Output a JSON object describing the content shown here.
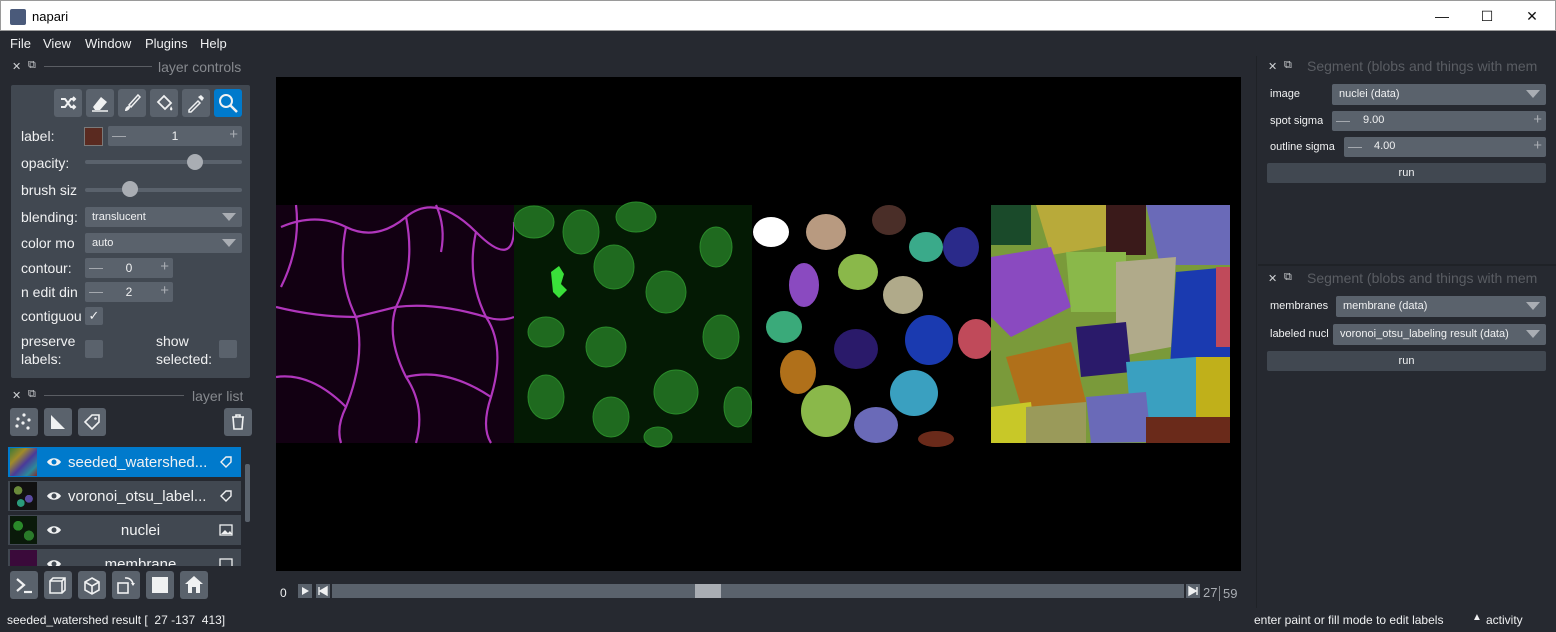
{
  "window": {
    "title": "napari",
    "minimize_icon": "minimize-icon",
    "maximize_icon": "maximize-icon",
    "close_icon": "close-icon"
  },
  "menu": [
    "File",
    "View",
    "Window",
    "Plugins",
    "Help"
  ],
  "layer_controls": {
    "header": "layer controls",
    "tools": [
      "shuffle-icon",
      "eraser-icon",
      "paintbrush-icon",
      "fill-bucket-icon",
      "color-picker-icon",
      "zoom-icon"
    ],
    "label": {
      "name": "label:",
      "value": "1",
      "color": "#5a2a20"
    },
    "opacity": {
      "name": "opacity:",
      "value": 0.72
    },
    "brush_size": {
      "name": "brush siz",
      "value": 0.26
    },
    "blending": {
      "name": "blending:",
      "value": "translucent"
    },
    "color_mode": {
      "name": "color mo",
      "value": "auto"
    },
    "contour": {
      "name": "contour:",
      "value": "0"
    },
    "n_edit_dim": {
      "name": "n edit din",
      "value": "2"
    },
    "contiguous": {
      "name": "contiguou",
      "checked": true
    },
    "preserve_labels": {
      "name1": "preserve",
      "name2": "labels:",
      "checked": false
    },
    "show_selected": {
      "name1": "show",
      "name2": "selected:",
      "checked": false
    }
  },
  "layer_list": {
    "header": "layer list",
    "layers": [
      {
        "name": "seeded_watershed...",
        "type": "labels",
        "selected": true
      },
      {
        "name": "voronoi_otsu_label...",
        "type": "labels",
        "selected": false
      },
      {
        "name": "nuclei",
        "type": "image",
        "selected": false
      },
      {
        "name": "membrane",
        "type": "image",
        "selected": false
      }
    ]
  },
  "dims": {
    "start": "0",
    "right_text_a": "27",
    "right_text_b": "59",
    "position": 0.44
  },
  "status": {
    "left": "seeded_watershed result [  27 -137  413]",
    "right": "enter paint or fill mode to edit labels",
    "activity": "activity"
  },
  "widget1": {
    "header": "Segment (blobs and things with mem",
    "image_label": "image",
    "image_value": "nuclei (data)",
    "spot_label": "spot sigma",
    "spot_value": "9.00",
    "outline_label": "outline sigma",
    "outline_value": "4.00",
    "run": "run"
  },
  "widget2": {
    "header": "Segment (blobs and things with mem",
    "membranes_label": "membranes",
    "membranes_value": "membrane (data)",
    "labeled_label": "labeled nucl",
    "labeled_value": "voronoi_otsu_labeling result (data)",
    "run": "run"
  },
  "colors": {
    "accent": "#007acc",
    "background": "#262930",
    "panel": "#414851",
    "control": "#5a626c",
    "text": "#f0f1f2"
  }
}
